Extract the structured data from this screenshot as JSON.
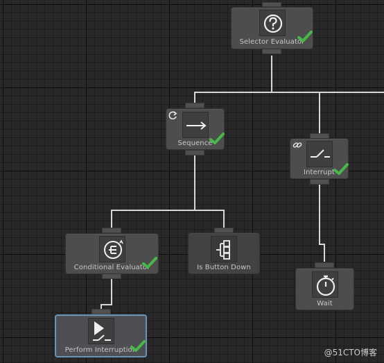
{
  "graph": {
    "nodes": {
      "selector": {
        "label": "Selector Evaluator",
        "icon": "question-circle-icon"
      },
      "sequence": {
        "label": "Sequence",
        "icon": "arrow-right-icon"
      },
      "interrupt": {
        "label": "Interrupt",
        "icon": "switch-icon"
      },
      "conditional": {
        "label": "Conditional Evaluator",
        "icon": "conditional-icon"
      },
      "button_down": {
        "label": "Is Button Down",
        "icon": "branch-icon"
      },
      "wait": {
        "label": "Wait",
        "icon": "stopwatch-icon"
      },
      "perform": {
        "label": "Perform Interruption",
        "icon": "play-switch-icon"
      }
    }
  },
  "watermark": "@51CTO博客",
  "colors": {
    "background": "#282828",
    "node": "#4d4d4d",
    "wire": "#d8d8d8",
    "success_check": "#48b848",
    "selected_outline": "#6a93b6"
  }
}
